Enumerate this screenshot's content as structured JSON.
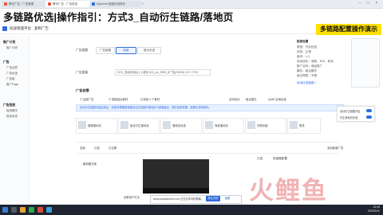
{
  "browser": {
    "tabs": [
      {
        "label": "腾讯广告 - 广告管理"
      },
      {
        "label": "腾讯广告 - 广告投放"
      },
      {
        "label": "Mysecret 链路优选操作"
      },
      {
        "label": "+"
      }
    ]
  },
  "overlay": {
    "title": "多链路优选|操作指引：方式3_自动衍生链路/落地页",
    "demo_label": "多链路配置操作演示"
  },
  "app": {
    "brand": "投放管理平台 · 复制广告"
  },
  "sidebar": {
    "groups": [
      {
        "label": "推广计划",
        "items": [
          "推广计划"
        ]
      },
      {
        "label": "广告",
        "items": [
          "广告创意",
          "广告优选",
          "广告组",
          "推广Page"
        ]
      },
      {
        "label": "广告投放",
        "items": [
          "投放概况",
          "投放状态"
        ]
      }
    ]
  },
  "form": {
    "ad_link_label": "广告链路",
    "ad_link_options": [
      "广告链路",
      "原版",
      "组合优选"
    ],
    "ad_url_label": "广告链接",
    "ad_url_value": "0371_落地页地址 | 小程序 (ID)_Ac_9999_B广告(RD0W) 1171.7729",
    "ad_creative_title": "广告创意",
    "options": [
      "连接广告",
      "智能组合素材",
      "已添加 3 个素材"
    ],
    "right_controls": [
      "自动优化",
      "组合模式",
      "Q&RI 启用优选"
    ],
    "info_bar": "自动衍生链路功能启用后，系统将根据原链路自动生成新的落地页与链路组合，提升投放效果，配置请谨慎操作。"
  },
  "cards": [
    {
      "label": "链路落地页"
    },
    {
      "label": "组合衍生落地页"
    },
    {
      "label": "落地页优选"
    },
    {
      "label": "商品落地页"
    },
    {
      "label": "详情页面"
    },
    {
      "label": "更多"
    }
  ],
  "lower": {
    "table_header": [
      "全部",
      "已选",
      "已过期"
    ],
    "tabs": [
      "已选",
      "多链路配置"
    ],
    "field": "副标题文案",
    "add_label": "添加新建广告",
    "check_label": "设置用户可见"
  },
  "right_panel": {
    "title": "投放设置",
    "lines": [
      "类型：开启优选",
      "状态：正常",
      "版本：1.0",
      "目标优化：收款、ROI、转化",
      "推广目标：商品推广",
      "模式：组合模式",
      "每日预算：不限"
    ],
    "link_text": "自动优选链路 >"
  },
  "popup": {
    "rows": [
      "自动衍生链路开启",
      "衍生落地页优选"
    ]
  },
  "video": {
    "share_text": "www.yuanwenmen.com 正在共享你的屏幕。",
    "share_button": "停止共享",
    "hide_button": "隐藏"
  },
  "watermark": "火鲤鱼",
  "taskbar": {
    "time": "13:49",
    "date": "2023/9/11"
  }
}
